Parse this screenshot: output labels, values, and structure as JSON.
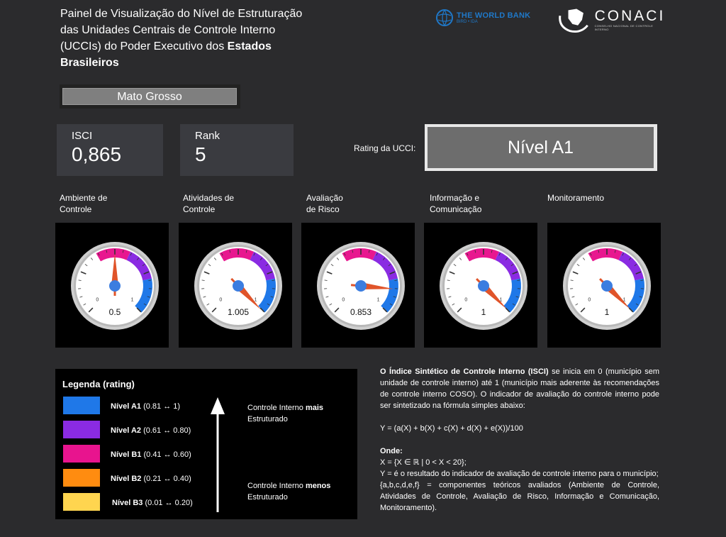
{
  "header": {
    "title_line1": "Painel de Visualização do Nível de Estruturação",
    "title_line2": "das Unidades Centrais de Controle Interno",
    "title_line3a": "(UCCIs) do Poder Executivo dos ",
    "title_line3b": "Estados",
    "title_line4": "Brasileiros"
  },
  "logos": {
    "worldbank_name": "THE WORLD BANK",
    "worldbank_sub": "BIRD • IDA",
    "conaci_name": "CONACI",
    "conaci_sub": "CONSELHO NACIONAL DE CONTROLE INTERNO"
  },
  "state_selector": {
    "value": "Mato Grosso"
  },
  "cards": {
    "isci_label": "ISCI",
    "isci_value": "0,865",
    "rank_label": "Rank",
    "rank_value": "5"
  },
  "rating": {
    "label": "Rating da UCCI:",
    "value": "Nível A1"
  },
  "gauges": [
    {
      "label_line1": "Ambiente de",
      "label_line2": "Controle",
      "value": 0.5,
      "display": "0.5"
    },
    {
      "label_line1": "Atividades de",
      "label_line2": "Controle",
      "value": 1.005,
      "display": "1.005"
    },
    {
      "label_line1": "Avaliação",
      "label_line2": "de Risco",
      "value": 0.853,
      "display": "0.853"
    },
    {
      "label_line1": "Informação e",
      "label_line2": "Comunicação",
      "value": 1,
      "display": "1"
    },
    {
      "label_line1": "Monitoramento",
      "label_line2": "",
      "value": 1,
      "display": "1"
    }
  ],
  "gauge_scale": {
    "min": "0",
    "max": "1",
    "band_colors": [
      "#e8178f",
      "#8a2be2",
      "#1f78e8"
    ]
  },
  "legend": {
    "title": "Legenda (rating)",
    "items": [
      {
        "level": "Nível A1",
        "range": " (0.81 ↔ 1)",
        "color": "#1f78e8"
      },
      {
        "level": "Nível A2",
        "range": " (0.61 ↔ 0.80)",
        "color": "#8a2be2"
      },
      {
        "level": "Nível B1",
        "range": " (0.41 ↔ 0.60)",
        "color": "#e8148e"
      },
      {
        "level": "Nível B2",
        "range": " (0.21 ↔ 0.40)",
        "color": "#ff8c10"
      },
      {
        "level": "Nível B3",
        "range": " (0.01 ↔ 0.20)",
        "color": "#ffd54f"
      }
    ],
    "top_text_a": "Controle Interno ",
    "top_text_b": "mais",
    "top_text_c": "Estruturado",
    "bottom_text_a": "Controle Interno ",
    "bottom_text_b": "menos",
    "bottom_text_c": "Estruturado"
  },
  "description": {
    "intro_bold": "O Índice Sintético de Controle Interno (ISCI)",
    "intro_rest": "  se inicia em 0 (município sem unidade de controle interno) até 1 (município mais aderente às recomendações de controle interno COSO). O indicador de avaliação do controle interno  pode ser sintetizado na fórmula simples abaixo:",
    "formula": "Y = (a(X) + b(X) + c(X) + d(X) + e(X))/100",
    "onde": "Onde:",
    "line_x": "X = {X ∈ ℝ | 0 < X < 20};",
    "line_y": "Y = é o resultado do indicador de avaliação de controle interno para o município;",
    "line_abc": "{a,b,c,d,e,f} = componentes teóricos avaliados (Ambiente de Controle, Atividades de Controle, Avaliação de Risco, Informação e Comunicação, Monitoramento)."
  }
}
